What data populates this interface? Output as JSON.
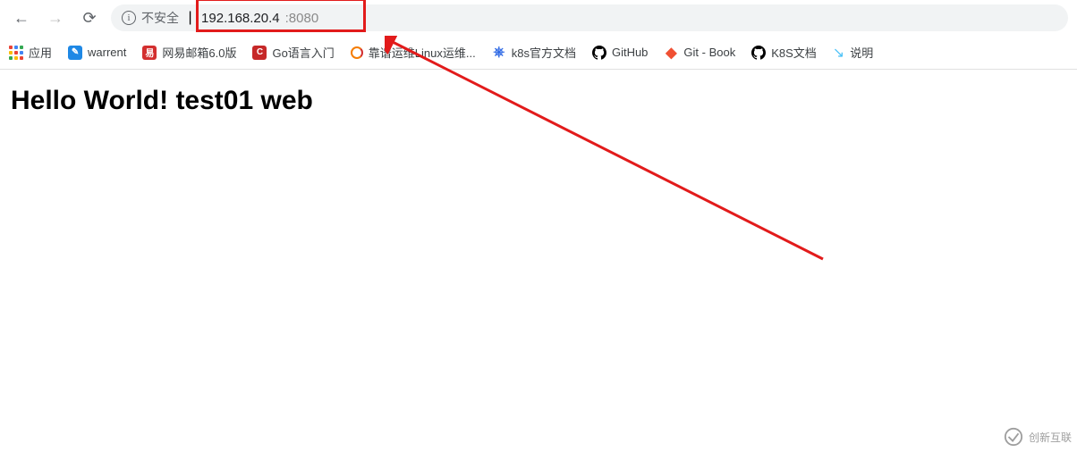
{
  "toolbar": {
    "secure_label": "不安全",
    "url_host": "192.168.20.4",
    "url_port": ":8080"
  },
  "bookmarks": {
    "apps": "应用",
    "items": [
      {
        "label": "warrent"
      },
      {
        "label": "网易邮箱6.0版"
      },
      {
        "label": "Go语言入门"
      },
      {
        "label": "靠谱运维Linux运维..."
      },
      {
        "label": "k8s官方文档"
      },
      {
        "label": "GitHub"
      },
      {
        "label": "Git - Book"
      },
      {
        "label": "K8S文档"
      },
      {
        "label": "说明"
      }
    ]
  },
  "page": {
    "heading": "Hello World! test01 web"
  },
  "watermark": {
    "text": "创新互联"
  }
}
